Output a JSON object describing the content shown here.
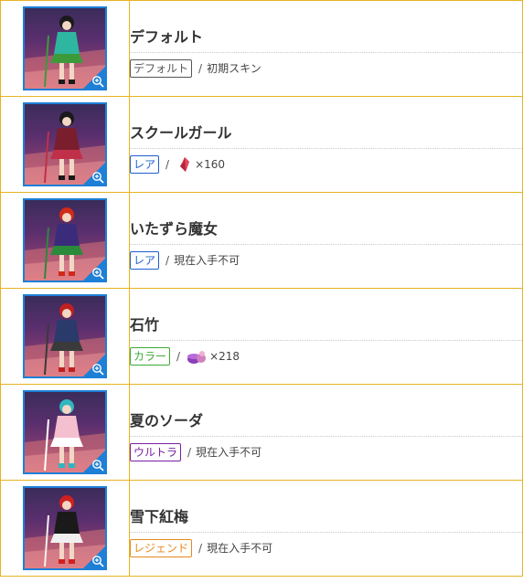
{
  "colors": {
    "border": "#e6b422",
    "zoom": "#1e7fd6",
    "default": "#555555",
    "rare": "#1e5fcf",
    "color": "#3aaa35",
    "ultra": "#7a1fa2",
    "legend": "#e6891e"
  },
  "skins": [
    {
      "name": "デフォルト",
      "rarity": "デフォルト",
      "rarity_key": "default",
      "separator": "/",
      "note": "初期スキン",
      "cost_icon": null,
      "qty": null
    },
    {
      "name": "スクールガール",
      "rarity": "レア",
      "rarity_key": "rare",
      "separator": "/",
      "note": null,
      "cost_icon": "ruby-gem-icon",
      "qty": "×160"
    },
    {
      "name": "いたずら魔女",
      "rarity": "レア",
      "rarity_key": "rare",
      "separator": "/",
      "note": "現在入手不可",
      "cost_icon": null,
      "qty": null
    },
    {
      "name": "石竹",
      "rarity": "カラー",
      "rarity_key": "color",
      "separator": "/",
      "note": null,
      "cost_icon": "dye-pot-icon",
      "qty": "×218"
    },
    {
      "name": "夏のソーダ",
      "rarity": "ウルトラ",
      "rarity_key": "ultra",
      "separator": "/",
      "note": "現在入手不可",
      "cost_icon": null,
      "qty": null
    },
    {
      "name": "雪下紅梅",
      "rarity": "レジェンド",
      "rarity_key": "legend",
      "separator": "/",
      "note": "現在入手不可",
      "cost_icon": null,
      "qty": null
    }
  ]
}
